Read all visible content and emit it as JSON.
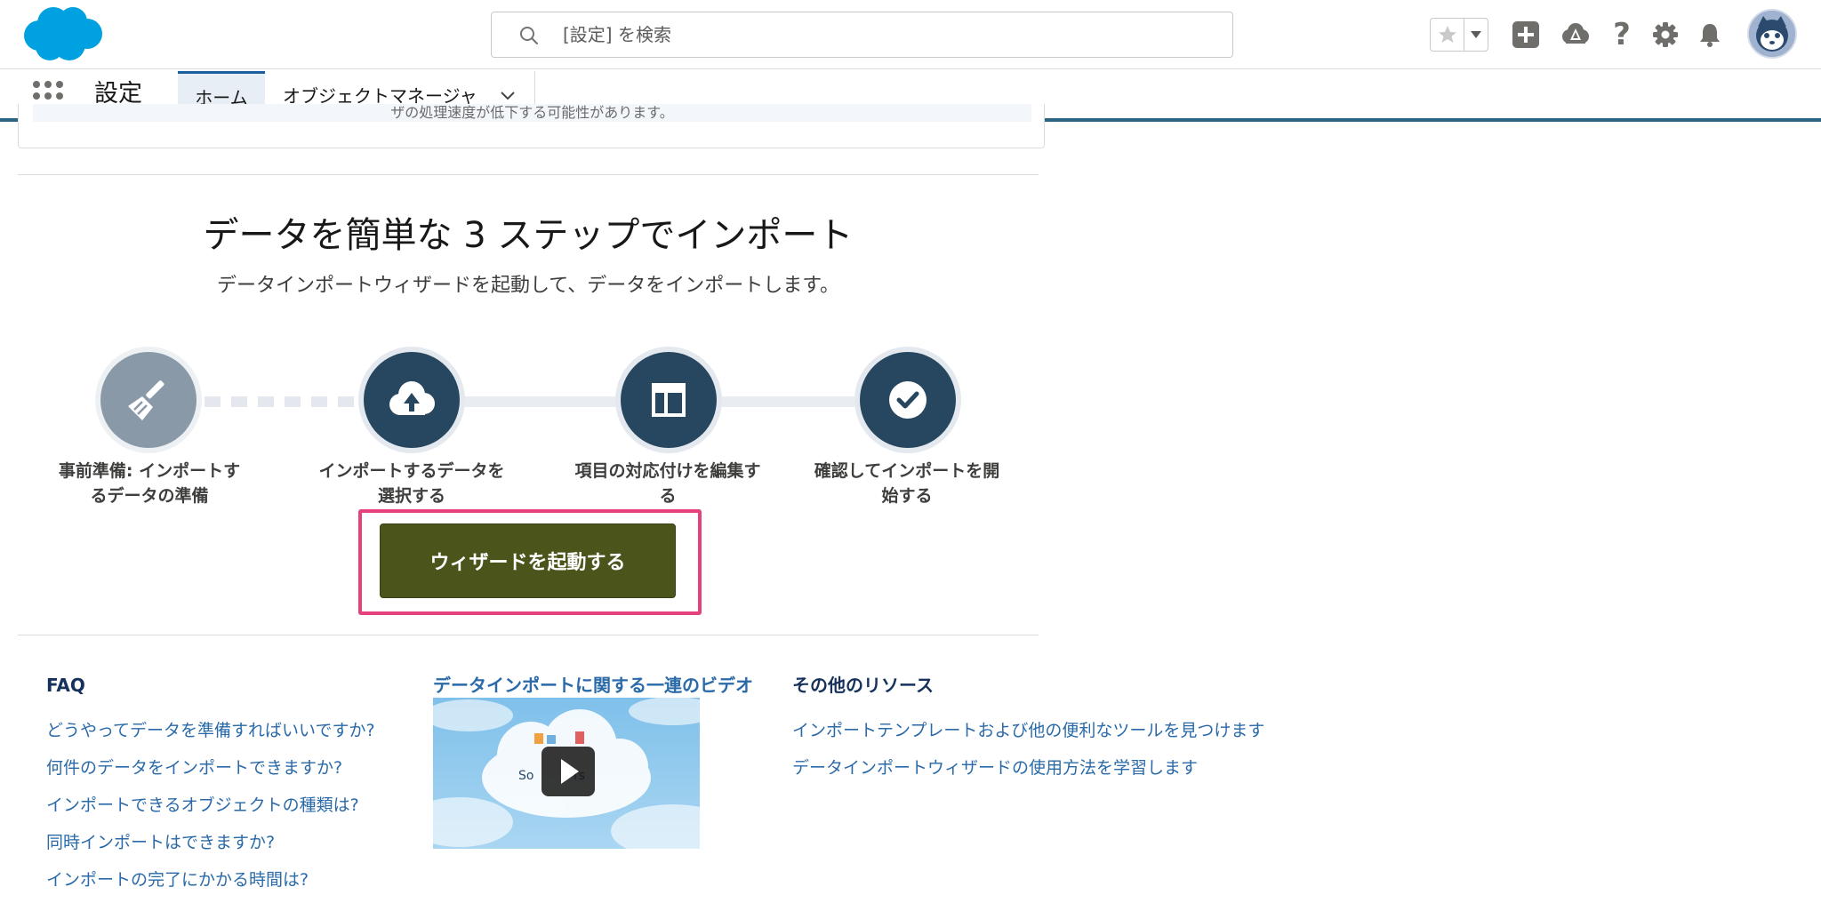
{
  "colors": {
    "brand_blue": "#00a1e0",
    "context_border": "#2b6382",
    "step_done": "#8a99a8",
    "step_todo": "#26475f",
    "wizard_button": "#4b541a",
    "highlight": "#e4417d",
    "link": "#2a6aa8",
    "heading": "#16325c"
  },
  "header": {
    "logo": "salesforce-cloud-logo",
    "search": {
      "placeholder": "[設定] を検索",
      "icon": "search-icon"
    },
    "icons": [
      "star-icon",
      "chevron-down-icon",
      "add-icon",
      "trailhead-icon",
      "help-icon",
      "gear-icon",
      "bell-icon",
      "avatar"
    ]
  },
  "context_bar": {
    "app_name": "設定",
    "tabs": [
      {
        "label": "ホーム",
        "active": true
      },
      {
        "label": "オブジェクトマネージャ",
        "active": false
      }
    ]
  },
  "notice": {
    "text": "ザの処理速度が低下する可能性があります。"
  },
  "import": {
    "title": "データを簡単な 3 ステップでインポート",
    "subtitle": "データインポートウィザードを起動して、データをインポートします。",
    "steps": [
      {
        "line1": "事前準備: インポートす",
        "line2": "るデータの準備",
        "icon": "broom-icon",
        "state": "done"
      },
      {
        "line1": "インポートするデータを",
        "line2": "選択する",
        "icon": "cloud-upload-icon",
        "state": "todo"
      },
      {
        "line1": "項目の対応付けを編集す",
        "line2": "る",
        "icon": "layout-icon",
        "state": "todo"
      },
      {
        "line1": "確認してインポートを開",
        "line2": "始する",
        "icon": "check-icon",
        "state": "todo"
      }
    ],
    "launch_button": "ウィザードを起動する"
  },
  "faq": {
    "heading": "FAQ",
    "links": [
      "どうやってデータを準備すればいいですか?",
      "何件のデータをインポートできますか?",
      "インポートできるオブジェクトの種類は?",
      "同時インポートはできますか?",
      "インポートの完了にかかる時間は?"
    ]
  },
  "video": {
    "title": "データインポートに関する一連のビデオ",
    "thumb_text": "So          rs"
  },
  "resources": {
    "heading": "その他のリソース",
    "links": [
      "インポートテンプレートおよび他の便利なツールを見つけます",
      "データインポートウィザードの使用方法を学習します"
    ]
  }
}
